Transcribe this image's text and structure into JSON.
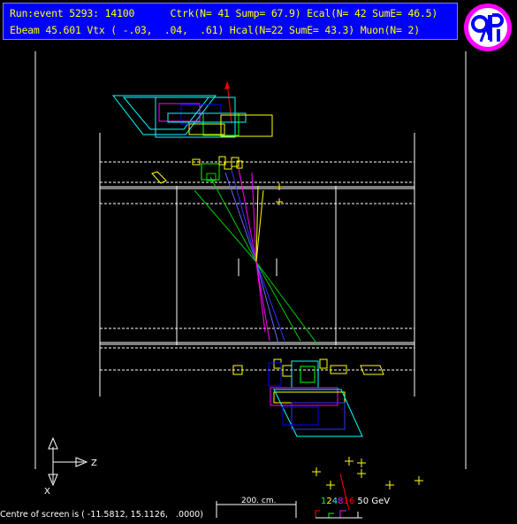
{
  "header": {
    "line1": "Run:event 5293: 14100      Ctrk(N= 41 Sump= 67.9) Ecal(N= 42 SumE= 46.5)",
    "line2": "Ebeam 45.601 Vtx ( -.03,  .04,  .61) Hcal(N=22 SumE= 43.3) Muon(N= 2)"
  },
  "logo": {
    "text": "OPAL",
    "colors": {
      "circle": "#ff00ff",
      "letters": "#0000ff"
    }
  },
  "axes": {
    "z_label": "Z",
    "x_label": "X"
  },
  "scale": {
    "label": "200. cm."
  },
  "energy_scale": {
    "digits": [
      "1",
      "2",
      "4",
      "8",
      "16"
    ],
    "unit": "50 GeV",
    "colors": [
      "#00ff00",
      "#ffff00",
      "#00ffff",
      "#ff00ff",
      "#ff0000"
    ]
  },
  "footer": {
    "centre_text": "Centre of screen is ( -11.5812, 15.1126,   .0000)"
  },
  "colors": {
    "background": "#000000",
    "header_bg": "#0000ff",
    "header_text": "#ffff00",
    "track_green": "#00cc00",
    "track_blue": "#3333ff",
    "track_magenta": "#ff00ff",
    "track_yellow": "#ffff00",
    "ecal": "#00ffff",
    "muon": "#ff0000"
  }
}
